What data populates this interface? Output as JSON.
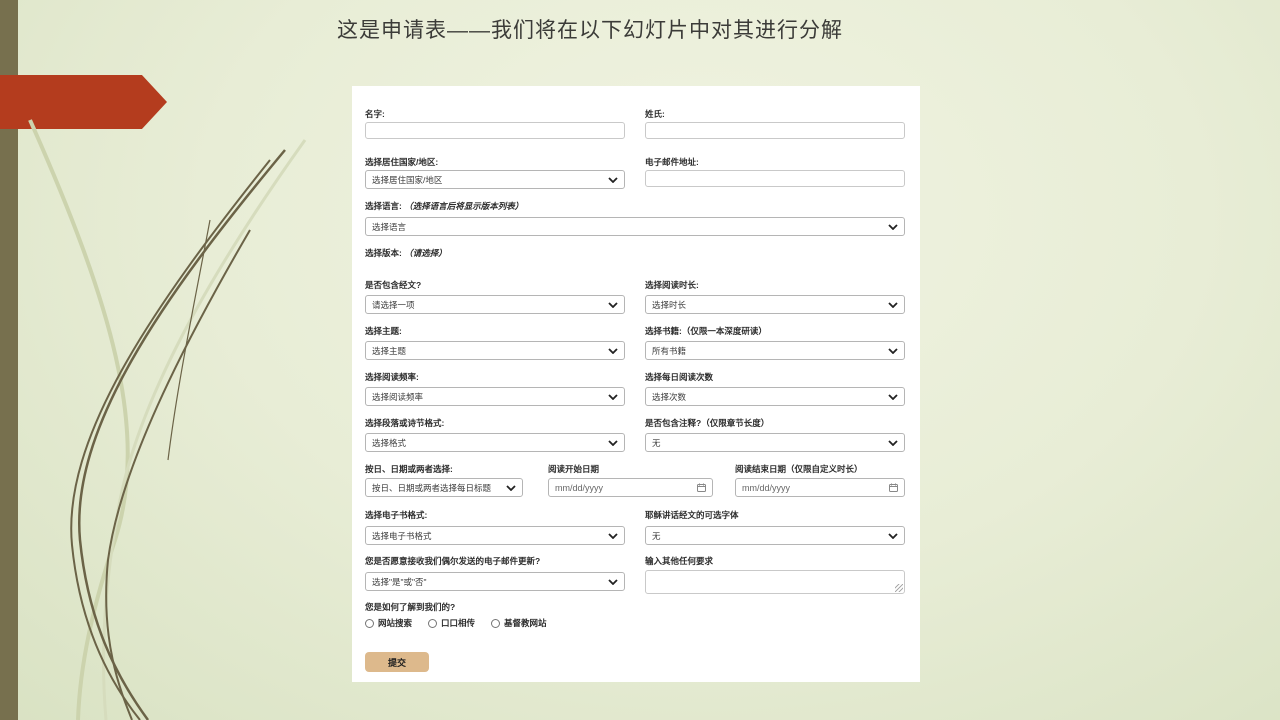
{
  "slide": {
    "title": "这是申请表——我们将在以下幻灯片中对其进行分解"
  },
  "colors": {
    "background": "#e8edd6",
    "side_bar": "#77704e",
    "arrow_red": "#b43c1e",
    "card": "#ffffff",
    "submit_bg": "#ddb98c",
    "grass_dark": "#6b6347",
    "grass_light": "#ccd3ad"
  },
  "form": {
    "first_name": {
      "label": "名字:"
    },
    "last_name": {
      "label": "姓氏:"
    },
    "country": {
      "label": "选择居住国家/地区:",
      "value": "选择居住国家/地区"
    },
    "email": {
      "label": "电子邮件地址:"
    },
    "language": {
      "label": "选择语言:",
      "note": "（选择语言后将显示版本列表）",
      "value": "选择语言"
    },
    "version": {
      "label": "选择版本:",
      "note": "（请选择）"
    },
    "scripture": {
      "label": "是否包含经文?",
      "value": "请选择一项"
    },
    "duration": {
      "label": "选择阅读时长:",
      "value": "选择时长"
    },
    "topic": {
      "label": "选择主题:",
      "value": "选择主题"
    },
    "book": {
      "label": "选择书籍:（仅限一本深度研读）",
      "value": "所有书籍"
    },
    "frequency": {
      "label": "选择阅读频率:",
      "value": "选择阅读频率"
    },
    "daily_times": {
      "label": "选择每日阅读次数",
      "value": "选择次数"
    },
    "passage_format": {
      "label": "选择段落或诗节格式:",
      "value": "选择格式"
    },
    "commentary": {
      "label": "是否包含注释?（仅限章节长度）",
      "value": "无"
    },
    "day_date": {
      "label": "按日、日期或两者选择:",
      "value": "按日、日期或两者选择每日标题"
    },
    "start_date": {
      "label": "阅读开始日期",
      "placeholder": "mm/dd/yyyy"
    },
    "end_date": {
      "label": "阅读结束日期（仅限自定义时长）",
      "placeholder": "mm/dd/yyyy"
    },
    "ebook": {
      "label": "选择电子书格式:",
      "value": "选择电子书格式"
    },
    "jesus_font": {
      "label": "耶稣讲话经文的可选字体",
      "value": "无"
    },
    "email_updates": {
      "label": "您是否愿意接收我们偶尔发送的电子邮件更新?",
      "value": "选择\"是\"或\"否\""
    },
    "other_requests": {
      "label": "输入其他任何要求"
    },
    "referral": {
      "label": "您是如何了解到我们的?",
      "options": [
        "网站搜索",
        "口口相传",
        "基督教网站"
      ]
    },
    "submit": {
      "label": "提交"
    }
  }
}
